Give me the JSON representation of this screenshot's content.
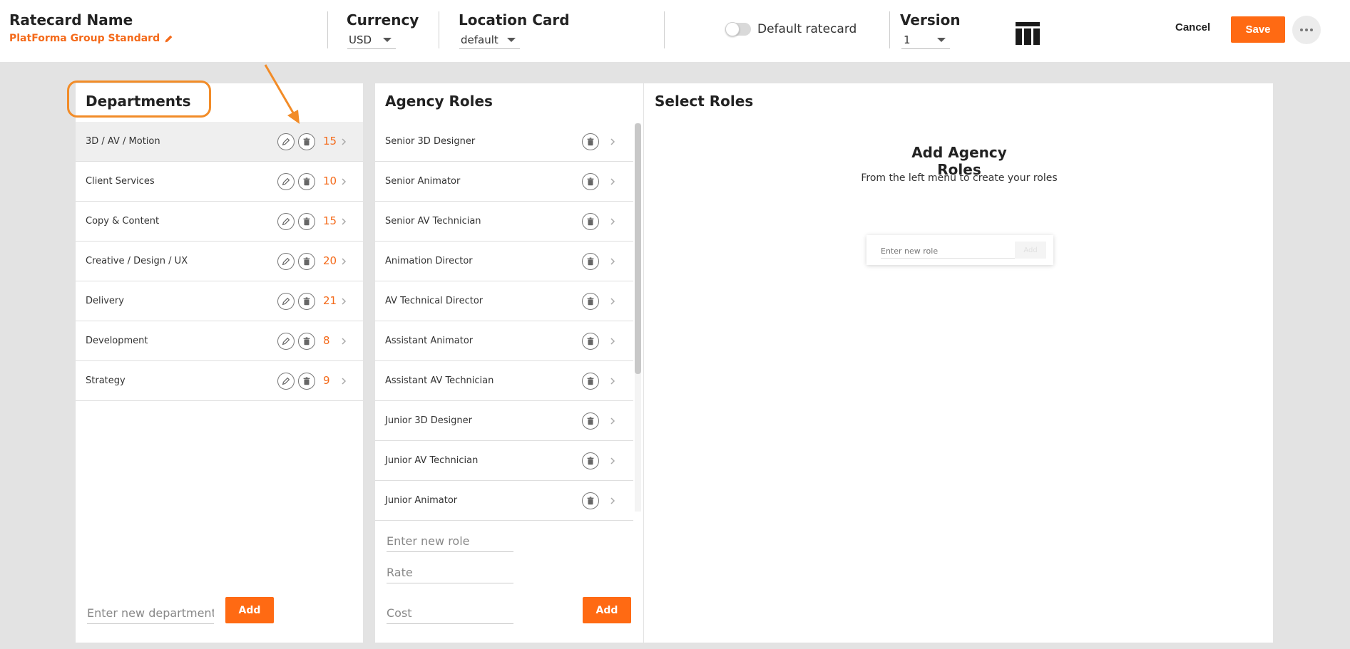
{
  "header": {
    "ratecard_label": "Ratecard Name",
    "ratecard_name": "PlatForma Group Standard",
    "currency_label": "Currency",
    "currency_value": "USD",
    "location_label": "Location Card",
    "location_value": "default",
    "default_toggle_label": "Default ratecard",
    "version_label": "Version",
    "version_value": "1",
    "cancel_label": "Cancel",
    "save_label": "Save"
  },
  "departments": {
    "title": "Departments",
    "items": [
      {
        "label": "3D / AV / Motion",
        "count": "15",
        "selected": true
      },
      {
        "label": "Client Services",
        "count": "10"
      },
      {
        "label": "Copy & Content",
        "count": "15"
      },
      {
        "label": "Creative / Design / UX",
        "count": "20"
      },
      {
        "label": "Delivery",
        "count": "21"
      },
      {
        "label": "Development",
        "count": "8"
      },
      {
        "label": "Strategy",
        "count": "9"
      }
    ],
    "new_placeholder": "Enter new department",
    "add_label": "Add"
  },
  "agency_roles": {
    "title": "Agency Roles",
    "items": [
      "Senior 3D Designer",
      "Senior Animator",
      "Senior AV Technician",
      "Animation Director",
      "AV Technical Director",
      "Assistant Animator",
      "Assistant AV Technician",
      "Junior 3D Designer",
      "Junior AV Technician",
      "Junior Animator"
    ],
    "role_placeholder": "Enter new role",
    "rate_placeholder": "Rate",
    "cost_placeholder": "Cost",
    "add_label": "Add"
  },
  "select_roles": {
    "title": "Select Roles",
    "empty_title": "Add Agency Roles",
    "empty_subtitle": "From the left menu to create your roles",
    "mini_placeholder": "Enter new role",
    "mini_add_label": "Add"
  },
  "colors": {
    "accent": "#ff6a13",
    "annotation": "#f28c28"
  }
}
